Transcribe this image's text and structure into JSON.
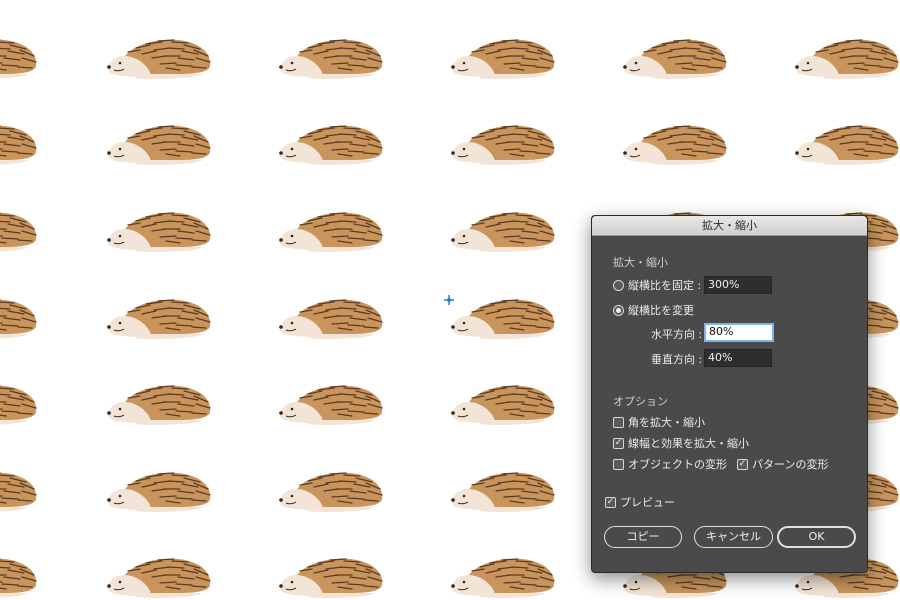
{
  "dialog": {
    "title": "拡大・縮小",
    "scale_section": "拡大・縮小",
    "uniform": {
      "label": "縦横比を固定 :",
      "value": "300%",
      "selected": false
    },
    "nonuniform": {
      "label": "縦横比を変更",
      "selected": true
    },
    "horizontal": {
      "label": "水平方向 :",
      "value": "80%"
    },
    "vertical": {
      "label": "垂直方向 :",
      "value": "40%"
    },
    "options_section": "オプション",
    "options": {
      "scale_corners": {
        "label": "角を拡大・縮小",
        "checked": false
      },
      "scale_strokes": {
        "label": "線幅と効果を拡大・縮小",
        "checked": true
      },
      "transform_objects": {
        "label": "オブジェクトの変形",
        "checked": false
      },
      "transform_patterns": {
        "label": "パターンの変形",
        "checked": true
      }
    },
    "preview": {
      "label": "プレビュー",
      "checked": true
    },
    "buttons": {
      "copy": "コピー",
      "cancel": "キャンセル",
      "ok": "OK"
    }
  },
  "colors": {
    "hedgehog_spines": "#c9955c",
    "hedgehog_spine_lines": "#5a3a22",
    "hedgehog_face": "#f2e4d6",
    "dialog_bg": "#4a4a4a",
    "field_focus_border": "#7fb0ef",
    "cursor": "#2a7fd4"
  },
  "icons": [
    "hedgehog-icon",
    "move-cursor-icon",
    "checkmark-icon"
  ]
}
